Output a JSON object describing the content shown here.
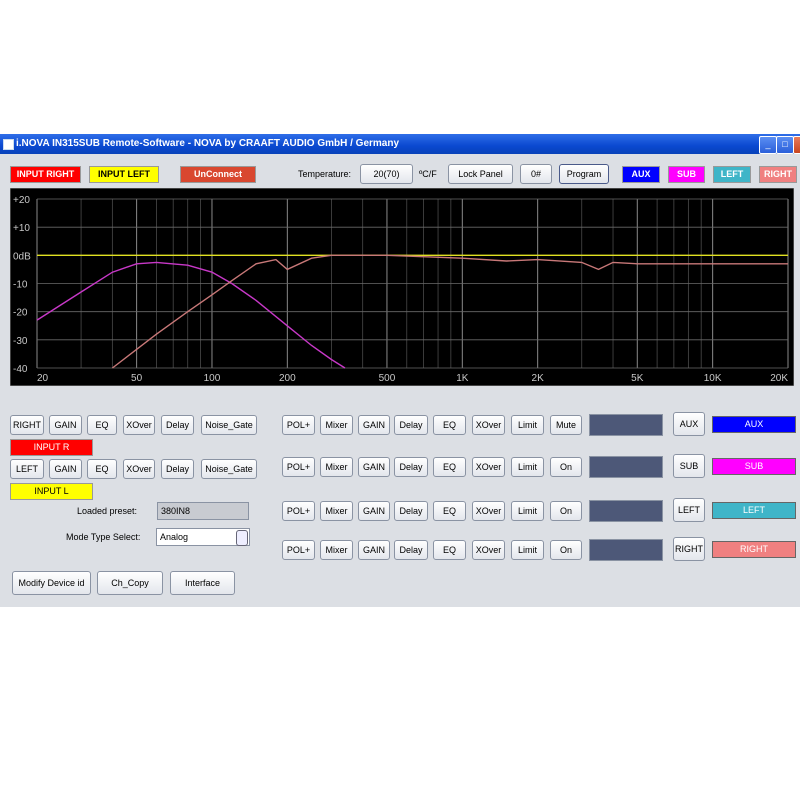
{
  "window": {
    "title": "i.NOVA IN315SUB Remote-Software - NOVA by CRAAFT AUDIO GmbH / Germany",
    "minimize": "_",
    "maximize": "□",
    "close": "×"
  },
  "top": {
    "input_right": "INPUT RIGHT",
    "input_left": "INPUT LEFT",
    "unconnect": "UnConnect",
    "temperature_label": "Temperature:",
    "temperature_value": "20(70)",
    "temperature_unit": "ºC/F",
    "lock_panel": "Lock Panel",
    "preset_no": "0#",
    "program": "Program",
    "channels": [
      "AUX",
      "SUB",
      "LEFT",
      "RIGHT"
    ]
  },
  "chart_data": {
    "type": "line",
    "x_scale": "log",
    "xlim": [
      20,
      20000
    ],
    "ylim": [
      -40,
      20
    ],
    "x_ticks": [
      "20",
      "50",
      "100",
      "200",
      "500",
      "1K",
      "2K",
      "5K",
      "10K",
      "20K"
    ],
    "y_ticks": [
      "+20",
      "+10",
      "0dB",
      "-10",
      "-20",
      "-30",
      "-40"
    ],
    "grid": true,
    "series": [
      {
        "color": "#e0e020",
        "x": [
          20,
          20000
        ],
        "y": [
          0,
          0
        ]
      },
      {
        "color": "#c838c8",
        "x": [
          20,
          30,
          40,
          50,
          60,
          80,
          100,
          120,
          150,
          200,
          250,
          300,
          340
        ],
        "y": [
          -23,
          -13,
          -6,
          -3,
          -2.5,
          -3.5,
          -6,
          -10,
          -16,
          -25,
          -32,
          -37,
          -40
        ]
      },
      {
        "color": "#c87878",
        "x": [
          40,
          60,
          80,
          100,
          120,
          150,
          180,
          200,
          250,
          300,
          500,
          1000,
          1500,
          2000,
          3000,
          3500,
          4000,
          5000,
          10000,
          20000
        ],
        "y": [
          -40,
          -28,
          -20,
          -14,
          -9,
          -3,
          -1.5,
          -5,
          -1,
          0,
          0,
          -1,
          -2,
          -1.5,
          -2.5,
          -5,
          -2.5,
          -3,
          -3,
          -3
        ]
      }
    ]
  },
  "input_rows": [
    {
      "buttons": [
        "RIGHT",
        "GAIN",
        "EQ",
        "XOver",
        "Delay",
        "Noise_Gate"
      ],
      "tag": "INPUT R",
      "tag_color": "#ff0000"
    },
    {
      "buttons": [
        "LEFT",
        "GAIN",
        "EQ",
        "XOver",
        "Delay",
        "Noise_Gate"
      ],
      "tag": "INPUT L",
      "tag_color": "#ffff00"
    }
  ],
  "loaded_preset": {
    "label": "Loaded preset:",
    "value": "380IN8"
  },
  "mode": {
    "label": "Mode Type Select:",
    "value": "Analog"
  },
  "bottom_buttons": [
    "Modify Device id",
    "Ch_Copy",
    "Interface"
  ],
  "output_rows": [
    {
      "buttons": [
        "POL+",
        "Mixer",
        "GAIN",
        "Delay",
        "EQ",
        "XOver",
        "Limit",
        "Mute"
      ],
      "select": "AUX",
      "channel": "AUX",
      "channel_bg": "#0000ff",
      "channel_fg": "#ffffff"
    },
    {
      "buttons": [
        "POL+",
        "Mixer",
        "GAIN",
        "Delay",
        "EQ",
        "XOver",
        "Limit",
        "On"
      ],
      "select": "SUB",
      "channel": "SUB",
      "channel_bg": "#ff00ff",
      "channel_fg": "#ffffff"
    },
    {
      "buttons": [
        "POL+",
        "Mixer",
        "GAIN",
        "Delay",
        "EQ",
        "XOver",
        "Limit",
        "On"
      ],
      "select": "LEFT",
      "channel": "LEFT",
      "channel_bg": "#3fb5c8",
      "channel_fg": "#ffffff"
    },
    {
      "buttons": [
        "POL+",
        "Mixer",
        "GAIN",
        "Delay",
        "EQ",
        "XOver",
        "Limit",
        "On"
      ],
      "select": "RIGHT",
      "channel": "RIGHT",
      "channel_bg": "#f08080",
      "channel_fg": "#ffffff"
    }
  ]
}
